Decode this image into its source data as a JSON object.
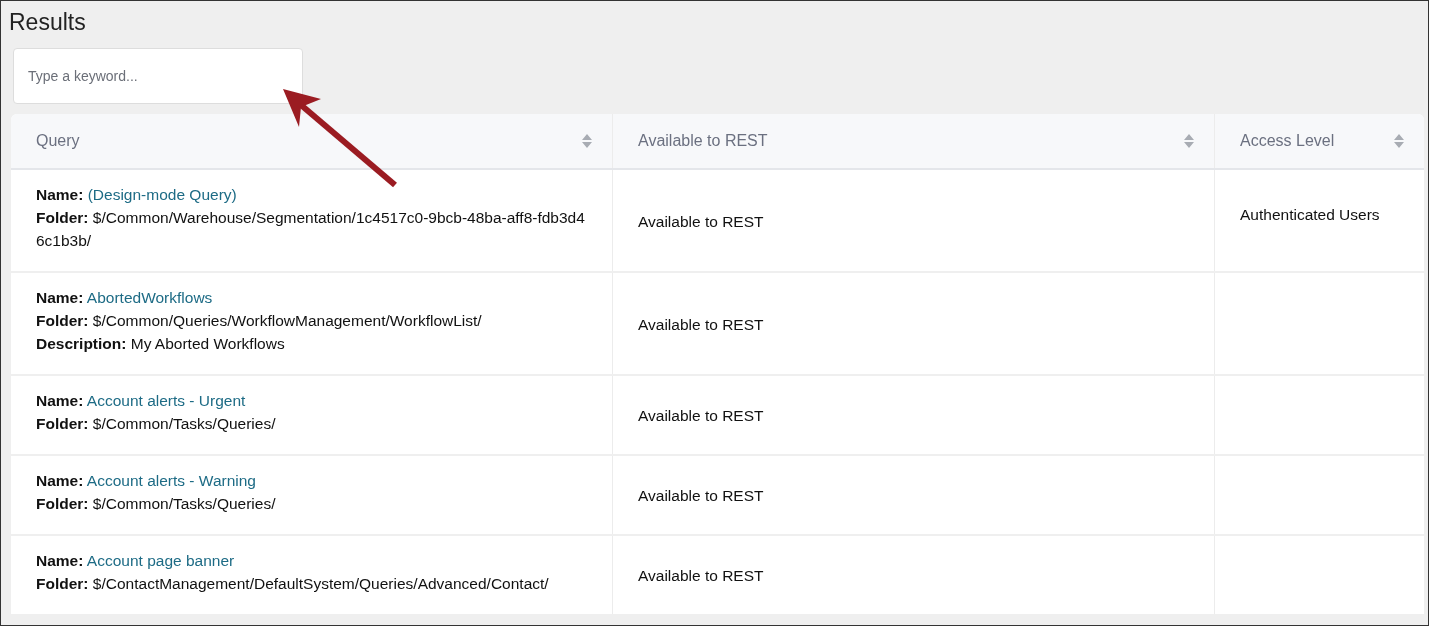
{
  "page": {
    "title": "Results"
  },
  "search": {
    "placeholder": "Type a keyword..."
  },
  "table": {
    "columns": [
      "Query",
      "Available to REST",
      "Access Level"
    ],
    "rows": [
      {
        "fields": [
          {
            "label": "Name:",
            "value": "(Design-mode Query)",
            "kind": "link"
          },
          {
            "label": "Folder:",
            "value": "$/Common/Warehouse/Segmentation/1c4517c0-9bcb-48ba-aff8-fdb3d46c1b3b/",
            "kind": "text"
          }
        ],
        "rest": "Available to REST",
        "access": "Authenticated Users"
      },
      {
        "fields": [
          {
            "label": "Name:",
            "value": "AbortedWorkflows",
            "kind": "link"
          },
          {
            "label": "Folder:",
            "value": "$/Common/Queries/WorkflowManagement/WorkflowList/",
            "kind": "text"
          },
          {
            "label": "Description:",
            "value": "My Aborted Workflows",
            "kind": "text"
          }
        ],
        "rest": "Available to REST"
      },
      {
        "fields": [
          {
            "label": "Name:",
            "value": "Account alerts - Urgent",
            "kind": "link"
          },
          {
            "label": "Folder:",
            "value": "$/Common/Tasks/Queries/",
            "kind": "text"
          }
        ],
        "rest": "Available to REST"
      },
      {
        "fields": [
          {
            "label": "Name:",
            "value": "Account alerts - Warning",
            "kind": "link"
          },
          {
            "label": "Folder:",
            "value": "$/Common/Tasks/Queries/",
            "kind": "text"
          }
        ],
        "rest": "Available to REST"
      },
      {
        "fields": [
          {
            "label": "Name:",
            "value": "Account page banner",
            "kind": "link"
          },
          {
            "label": "Folder:",
            "value": "$/ContactManagement/DefaultSystem/Queries/Advanced/Contact/",
            "kind": "text"
          }
        ],
        "rest": "Available to REST"
      }
    ]
  }
}
